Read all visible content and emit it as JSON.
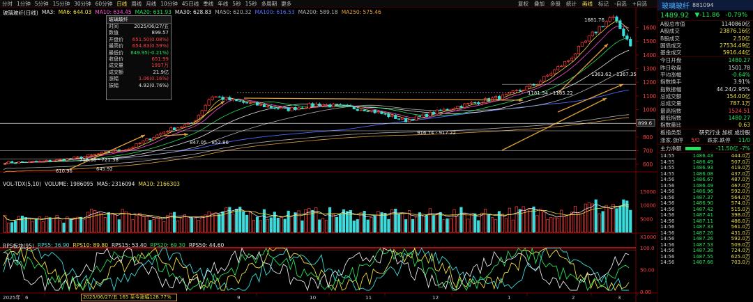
{
  "toolbar": {
    "periods": [
      "分时",
      "1分钟",
      "5分钟",
      "15分钟",
      "30分钟",
      "60分钟",
      "日线",
      "周线",
      "月线",
      "10分钟",
      "45日线",
      "季线",
      "年线",
      "5秒",
      "15秒",
      "多周期",
      "更多"
    ],
    "active_period": "日线",
    "actions": [
      "复权",
      "叠加",
      "多股",
      "统计",
      "画线",
      "标记",
      "-自选",
      "+自选"
    ],
    "active_action": "画线"
  },
  "main_legend": {
    "name": "玻璃玻纤(日线)",
    "ma3": "MA3: ",
    "ma6": "MA6: 644.03",
    "ma10": "MA10: 634.45",
    "ma20": "MA20: 631.93",
    "ma30": "MA30: 628.83",
    "ma50": "MA50: 620.32",
    "ma100": "MA100: 616.53",
    "ma200": "MA200: 589.18",
    "ma250": "MA250: 575.46"
  },
  "volume_legend": {
    "name": "VOL-TDX(5,10)",
    "volume": "VOLUME: 1986095",
    "ma5": "MA5: 2316094",
    "ma10": "MA10: 2166303"
  },
  "rps_legend": {
    "name": "RPS板块(95)",
    "rps5": "RPS5: 36.90",
    "rps10": "RPS10: 89.80",
    "rps15": "RPS15: 53.40",
    "rps20": "RPS20: 69.30",
    "rps50": "RPS50: 44.60"
  },
  "popup": {
    "title": "玻璃玻纤",
    "rows": [
      {
        "k": "时间",
        "v": "2025/06/27/五",
        "c": ""
      },
      {
        "k": "数值",
        "v": "899.57",
        "c": ""
      },
      {
        "k": "开盘价",
        "v": "651.50(0.08%)",
        "c": "up"
      },
      {
        "k": "最高价",
        "v": "654.83(0.59%)",
        "c": "up"
      },
      {
        "k": "最低价",
        "v": "649.95(-0.21%)",
        "c": "dn"
      },
      {
        "k": "收盘价",
        "v": "651.99",
        "c": "up"
      },
      {
        "k": "成交量",
        "v": "1997万",
        "c": "up"
      },
      {
        "k": "成交额",
        "v": "21.9亿",
        "c": ""
      },
      {
        "k": "涨幅",
        "v": "1.06(0.16%)",
        "c": "up"
      },
      {
        "k": "振幅",
        "v": "4.92(0.76%)",
        "c": ""
      }
    ]
  },
  "annotations": {
    "high": "1681.76",
    "range1": "1363.62 - 1367.35",
    "range2": "1181.34 - 1185.22",
    "range3": "916.74 - 917.22",
    "range4": "847.05 - 852.86",
    "range5": "716.38 - 721.38",
    "low1": "610.96",
    "low2": "645.92",
    "cursor_value": "899.6"
  },
  "price_axis": [
    "1600",
    "1500",
    "1400",
    "1300",
    "1200",
    "1100",
    "1000",
    "900",
    "800",
    "700",
    "600"
  ],
  "volume_axis": [
    "15000",
    "10000",
    "5000",
    "X1000"
  ],
  "rps_axis": [
    "100.0",
    "50.00",
    "0.00"
  ],
  "date_axis": [
    "2025年",
    "6",
    "9",
    "10",
    "11",
    "12",
    "1",
    "2",
    "3"
  ],
  "date_marker": "2025/06/27/五 165 至今涨幅128.77%",
  "panel": {
    "name": "玻璃玻纤",
    "code": "881094",
    "price": "1489.92",
    "change": "▼-11.86",
    "change_pct": "-0.79%",
    "stats": [
      {
        "k": "A股总市值",
        "v": "1140860亿",
        "c": ""
      },
      {
        "k": "A股成交",
        "v": "23876.16亿",
        "c": "yellow"
      },
      {
        "k": "B股成交",
        "v": "2.50亿",
        "c": "yellow"
      },
      {
        "k": "国债成交",
        "v": "27534.49亿",
        "c": "yellow"
      },
      {
        "k": "基金成交",
        "v": "5916.44亿",
        "c": "yellow"
      }
    ],
    "quotes": [
      {
        "k": "今日开盘",
        "v": "1480.27",
        "c": "green"
      },
      {
        "k": "昨日收盘",
        "v": "1501.78",
        "c": ""
      },
      {
        "k": "平均涨幅",
        "v": "-0.64%",
        "c": "green"
      },
      {
        "k": "指数换手",
        "v": "3.91%",
        "c": ""
      },
      {
        "k": "指数振幅",
        "v": "44.24/2.95%",
        "c": ""
      },
      {
        "k": "总成交额",
        "v": "154.00亿",
        "c": "yellow"
      },
      {
        "k": "总成交量",
        "v": "787.1万",
        "c": "yellow"
      },
      {
        "k": "最高指数",
        "v": "1524.51",
        "c": "red"
      },
      {
        "k": "最低指数",
        "v": "1480.27",
        "c": "green"
      },
      {
        "k": "指数量比",
        "v": "0.63",
        "c": "yellow"
      }
    ],
    "board_type_label": "板指类型",
    "board_type_value": "研究行业 加权 成份股",
    "rise_fall_label": "涨家.涨停",
    "rise_fall_value": "5/0",
    "fall_label": "跌家.跌停",
    "fall_value": "11/0",
    "main_net_label": "主力净额",
    "main_net_value": "-11.50亿 -7%",
    "ticks": [
      {
        "t": "14:55",
        "p": "1486.43",
        "v": "444.0万"
      },
      {
        "t": "14:55",
        "p": "1486.49",
        "v": "507.0万"
      },
      {
        "t": "14:55",
        "p": "1486.93",
        "v": "419.0万"
      },
      {
        "t": "14:55",
        "p": "1486.08",
        "v": "437.0万"
      },
      {
        "t": "14:56",
        "p": "1486.67",
        "v": "487.0万"
      },
      {
        "t": "14:56",
        "p": "1486.49",
        "v": "467.0万"
      },
      {
        "t": "14:56",
        "p": "1486.96",
        "v": "592.0万"
      },
      {
        "t": "14:56",
        "p": "1487.37",
        "v": "564.0万"
      },
      {
        "t": "14:56",
        "p": "1486.90",
        "v": "574.0万"
      },
      {
        "t": "14:56",
        "p": "1487.42",
        "v": "515.0万"
      },
      {
        "t": "14:56",
        "p": "1487.41",
        "v": "398.0万"
      },
      {
        "t": "14:56",
        "p": "1487.11",
        "v": "486.0万"
      },
      {
        "t": "14:56",
        "p": "1487.33",
        "v": "561.0万"
      },
      {
        "t": "14:56",
        "p": "1487.26",
        "v": "431.0万"
      },
      {
        "t": "14:56",
        "p": "1487.26",
        "v": "592.0万"
      },
      {
        "t": "14:56",
        "p": "1487.53",
        "v": "509.0万"
      },
      {
        "t": "14:56",
        "p": "1487.38",
        "v": "724.0万"
      },
      {
        "t": "14:56",
        "p": "1487.55",
        "v": "625.0万"
      },
      {
        "t": "14:56",
        "p": "1487.66",
        "v": "703.0万"
      }
    ]
  }
}
